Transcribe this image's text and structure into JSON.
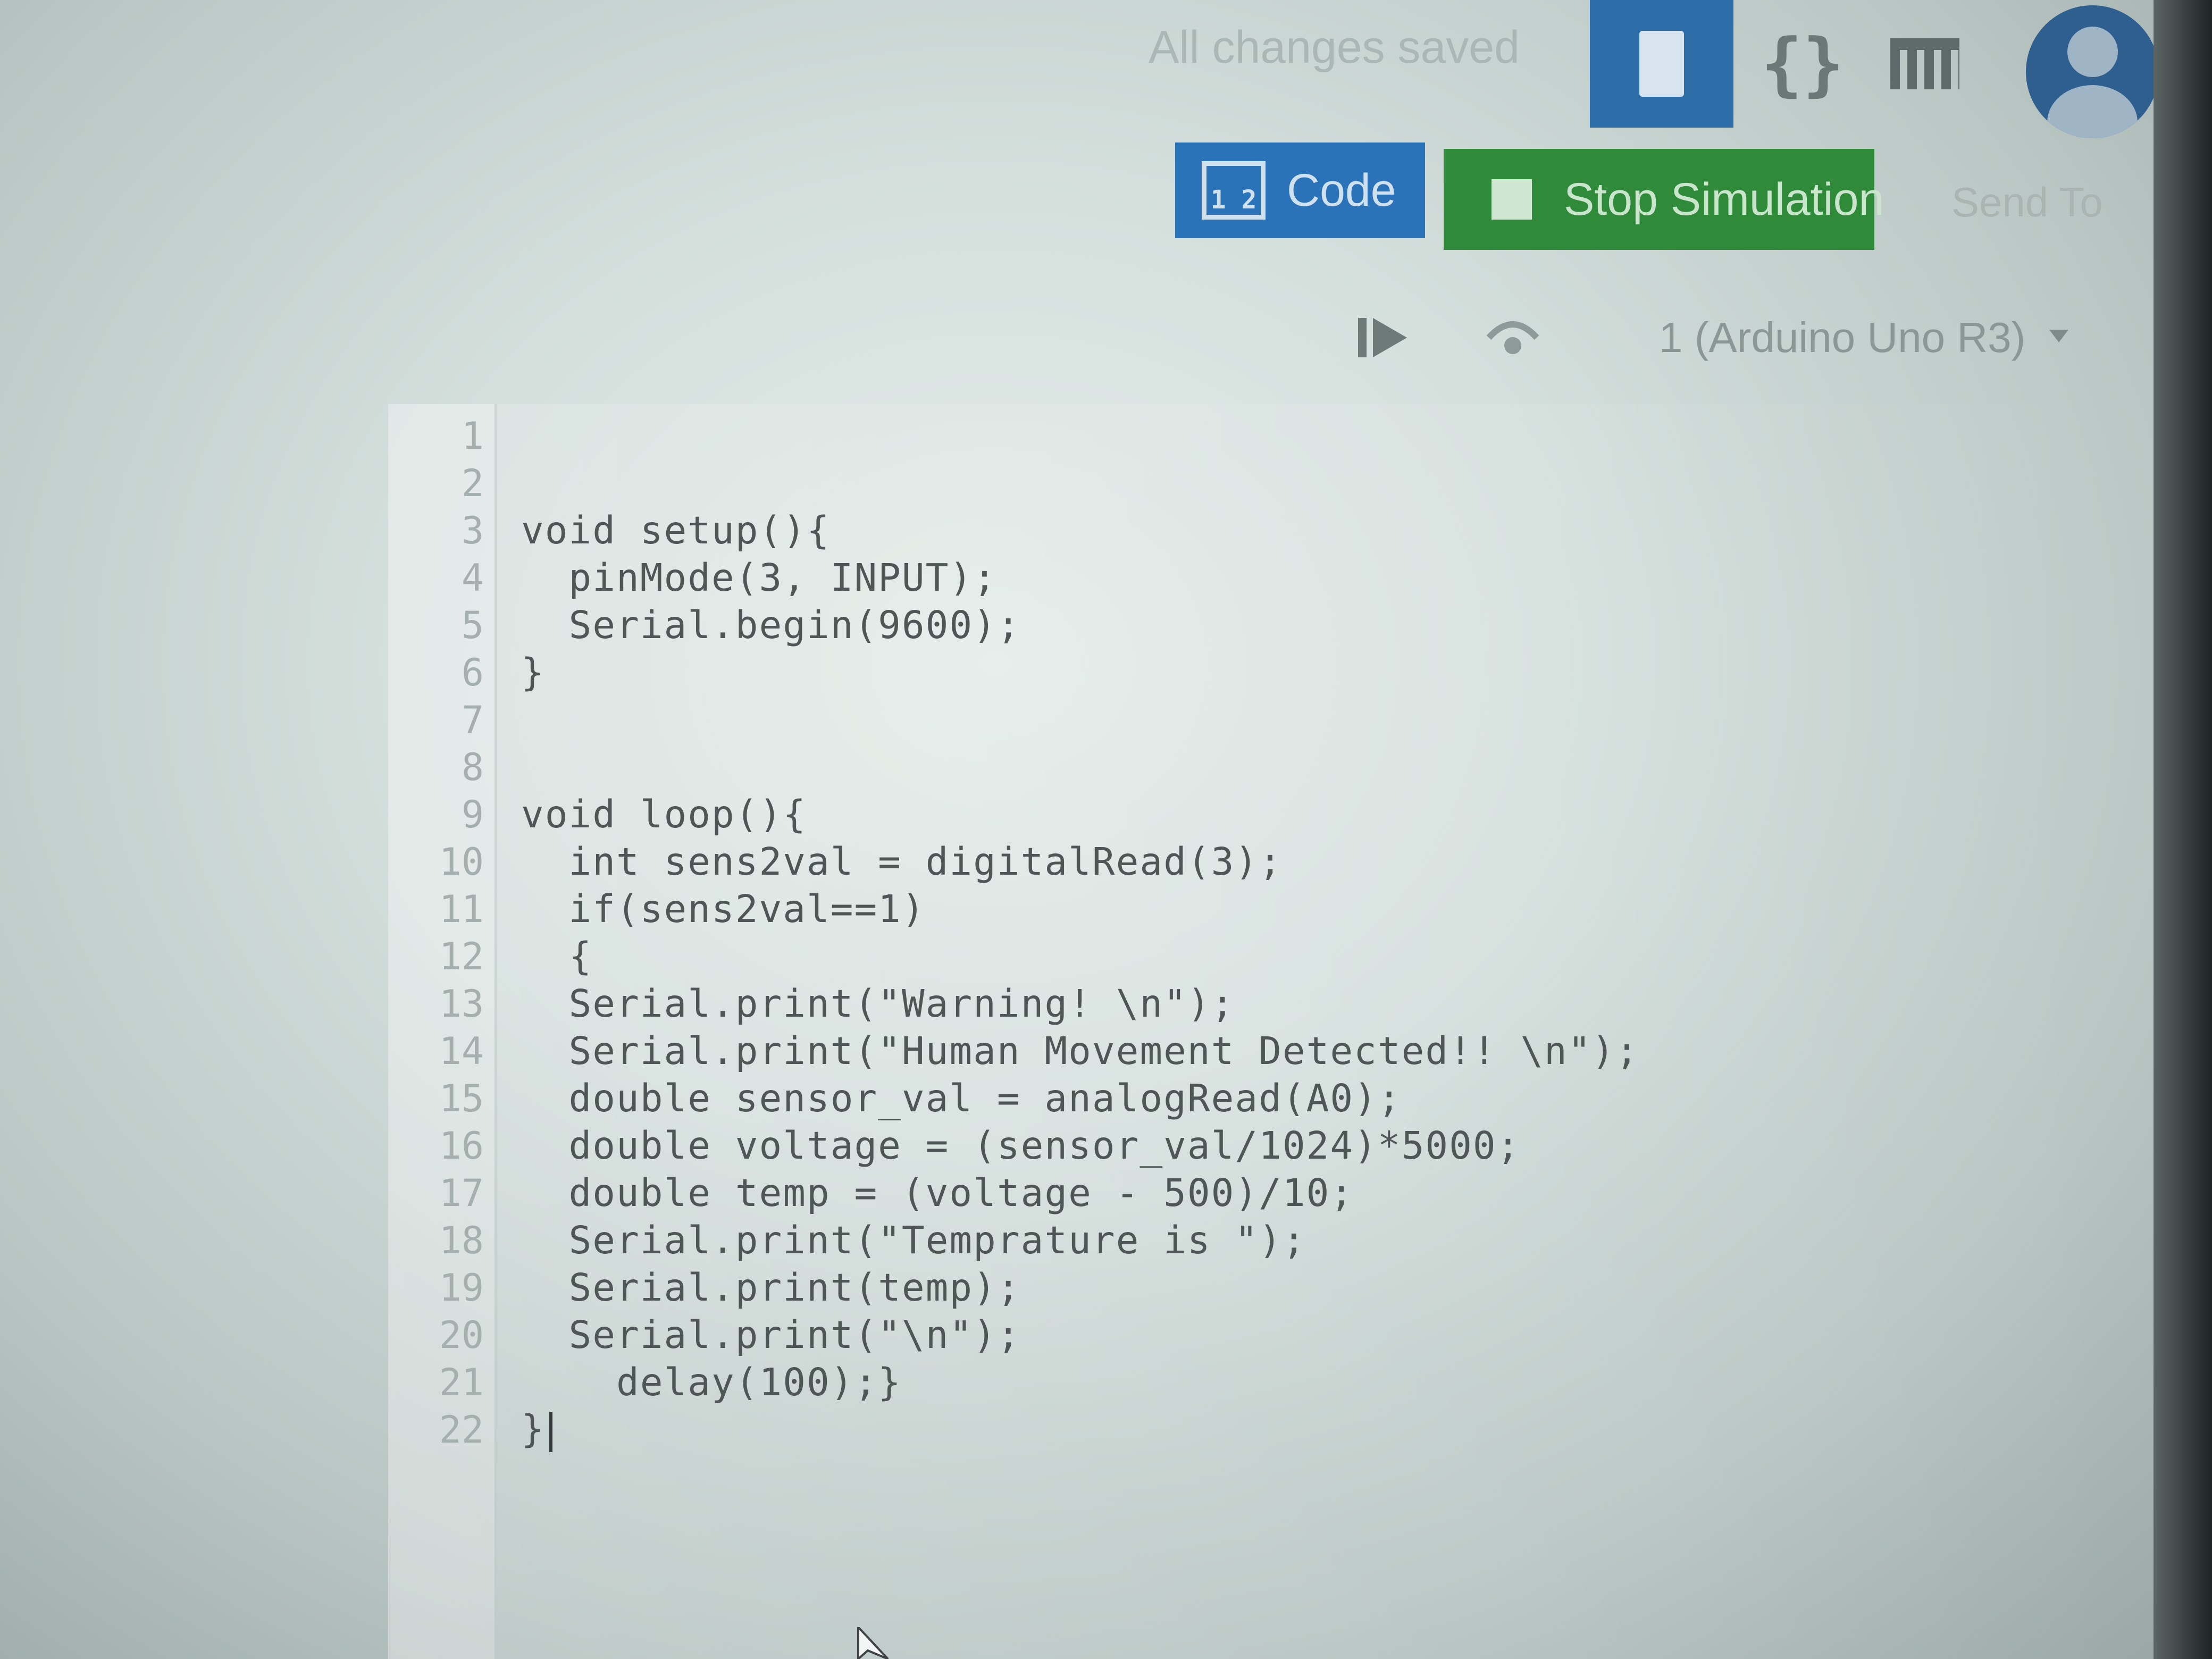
{
  "header": {
    "save_status": "All changes saved",
    "schematic_glyph": "{}"
  },
  "icons": {
    "circuit_view": "chip-icon",
    "schematic_view": "braces-icon",
    "component_list": "list-icon",
    "avatar": "user-avatar-icon",
    "code": "code-icon",
    "stop": "stop-icon",
    "step": "step-icon",
    "debug": "debug-icon",
    "dropdown": "chevron-down-icon"
  },
  "toolbar": {
    "code_label": "Code",
    "code_icon_text": "1 2",
    "stop_label": "Stop Simulation",
    "send_to_label": "Send To",
    "device_selected": "1 (Arduino Uno R3)"
  },
  "editor": {
    "lines": [
      {
        "num": "1",
        "code": ""
      },
      {
        "num": "2",
        "code": ""
      },
      {
        "num": "3",
        "code": "void setup(){"
      },
      {
        "num": "4",
        "code": "  pinMode(3, INPUT);"
      },
      {
        "num": "5",
        "code": "  Serial.begin(9600);"
      },
      {
        "num": "6",
        "code": "}"
      },
      {
        "num": "7",
        "code": ""
      },
      {
        "num": "8",
        "code": ""
      },
      {
        "num": "9",
        "code": "void loop(){"
      },
      {
        "num": "10",
        "code": "  int sens2val = digitalRead(3);"
      },
      {
        "num": "11",
        "code": "  if(sens2val==1)"
      },
      {
        "num": "12",
        "code": "  {"
      },
      {
        "num": "13",
        "code": "  Serial.print(\"Warning! \\n\");"
      },
      {
        "num": "14",
        "code": "  Serial.print(\"Human Movement Detected!! \\n\");"
      },
      {
        "num": "15",
        "code": "  double sensor_val = analogRead(A0);"
      },
      {
        "num": "16",
        "code": "  double voltage = (sensor_val/1024)*5000;"
      },
      {
        "num": "17",
        "code": "  double temp = (voltage - 500)/10;"
      },
      {
        "num": "18",
        "code": "  Serial.print(\"Temprature is \");"
      },
      {
        "num": "19",
        "code": "  Serial.print(temp);"
      },
      {
        "num": "20",
        "code": "  Serial.print(\"\\n\");"
      },
      {
        "num": "21",
        "code": "    delay(100);}"
      },
      {
        "num": "22",
        "code": "}"
      }
    ]
  },
  "colors": {
    "circuit_button": "#2e6ea8",
    "code_button": "#2b73b9",
    "stop_button": "#2f8a3a",
    "code_text": "#4e5755"
  }
}
